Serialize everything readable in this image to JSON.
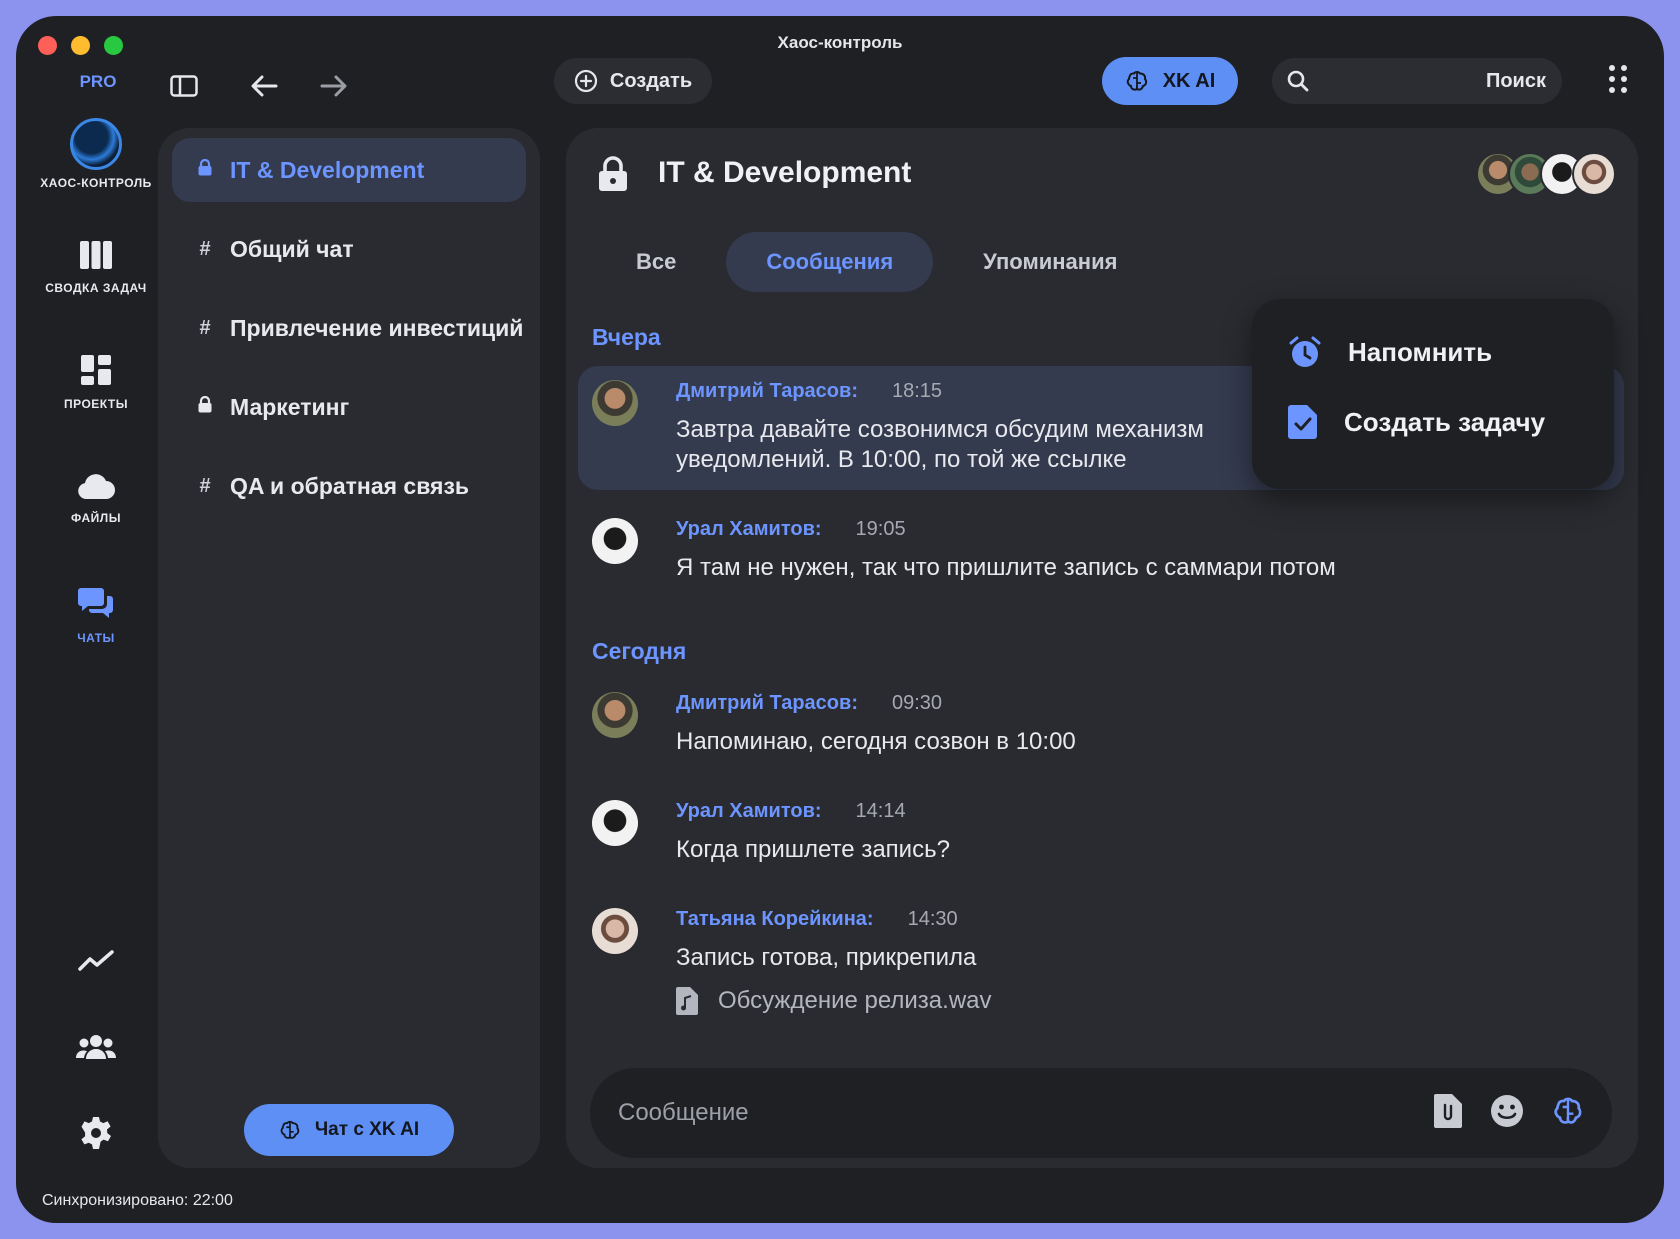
{
  "window": {
    "title": "Хаос-контроль"
  },
  "topbar": {
    "plan_badge": "PRO",
    "create_label": "Создать",
    "ai_label": "XK AI",
    "search_label": "Поиск"
  },
  "rail": {
    "logo_label": "ХАОС-КОНТРОЛЬ",
    "items": [
      {
        "label": "СВОДКА ЗАДАЧ",
        "icon": "columns-icon"
      },
      {
        "label": "ПРОЕКТЫ",
        "icon": "dashboard-icon"
      },
      {
        "label": "ФАЙЛЫ",
        "icon": "cloud-icon"
      },
      {
        "label": "ЧАТЫ",
        "icon": "chat-icon",
        "active": true
      }
    ]
  },
  "channels": {
    "items": [
      {
        "label": "IT & Development",
        "prefix": "lock",
        "active": true
      },
      {
        "label": "Общий чат",
        "prefix": "#"
      },
      {
        "label": "Привлечение инвестиций",
        "prefix": "#"
      },
      {
        "label": "Маркетинг",
        "prefix": "lock"
      },
      {
        "label": "QA и обратная связь",
        "prefix": "#"
      }
    ],
    "chat_ai_label": "Чат с XK AI"
  },
  "chat": {
    "title": "IT & Development",
    "tabs": [
      "Все",
      "Сообщения",
      "Упоминания"
    ],
    "active_tab": "Сообщения",
    "days": [
      "Вчера",
      "Сегодня"
    ],
    "messages": [
      {
        "author": "Дмитрий Тарасов:",
        "time": "18:15",
        "text": "Завтра давайте созвонимся обсудим механизм уведомлений. В 10:00, по той же ссылке"
      },
      {
        "author": "Урал Хамитов:",
        "time": "19:05",
        "text": "Я там не нужен, так что пришлите запись с саммари потом"
      },
      {
        "author": "Дмитрий Тарасов:",
        "time": "09:30",
        "text": "Напоминаю, сегодня созвон в 10:00"
      },
      {
        "author": "Урал Хамитов:",
        "time": "14:14",
        "text": "Когда пришлете запись?"
      },
      {
        "author": "Татьяна Корейкина:",
        "time": "14:30",
        "text": "Запись готова, прикрепила",
        "attachment": "Обсуждение релиза.wav"
      }
    ],
    "context_menu": [
      "Напомнить",
      "Создать задачу"
    ],
    "composer_placeholder": "Сообщение"
  },
  "status": {
    "sync_text": "Синхронизировано: 22:00"
  },
  "colors": {
    "accent": "#6d95ff",
    "button": "#5d8ff5",
    "bg": "#1f2024",
    "panel": "#2a2b30",
    "highlight": "#343b4f"
  }
}
